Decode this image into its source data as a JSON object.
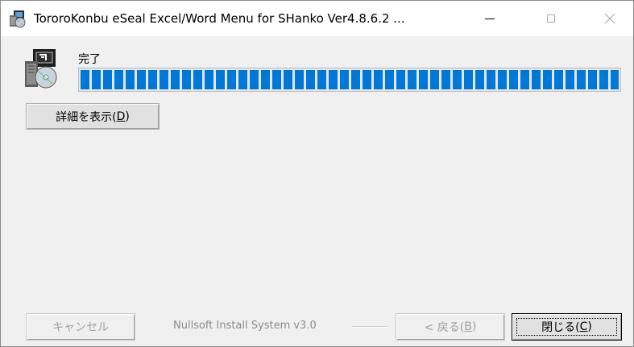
{
  "window": {
    "title": "TororoKonbu eSeal Excel/Word Menu for SHanko Ver4.8.6.2 ...",
    "app_icon": "installer-icon",
    "controls": {
      "minimize_icon": "minimize-icon",
      "maximize_icon": "maximize-icon",
      "close_icon": "close-icon"
    }
  },
  "status": {
    "text": "完了",
    "progress_percent": 100,
    "progress_color": "#0078d7",
    "header_icon": "installer-disc-icon"
  },
  "details_button": {
    "label": "詳細を表示(",
    "accel": "D",
    "suffix": ")"
  },
  "footer": {
    "cancel_label": "キャンセル",
    "branding": "Nullsoft Install System v3.0",
    "back": {
      "label": "< 戻る(",
      "accel": "B",
      "suffix": ")"
    },
    "close": {
      "label": "閉じる(",
      "accel": "C",
      "suffix": ")"
    }
  }
}
